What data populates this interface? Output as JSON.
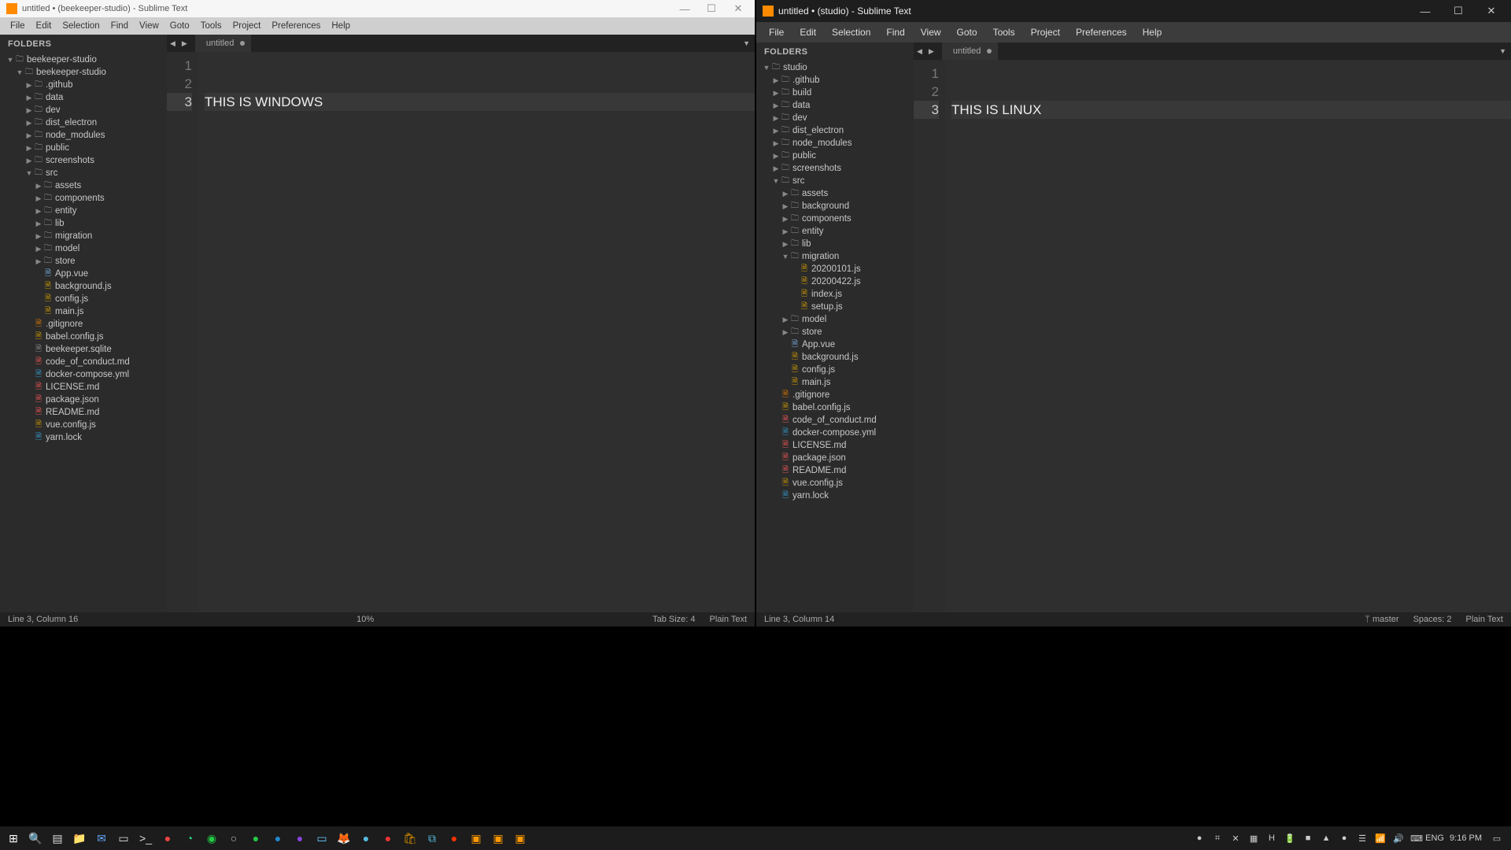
{
  "left": {
    "title": "untitled • (beekeeper-studio) - Sublime Text",
    "menus": [
      "File",
      "Edit",
      "Selection",
      "Find",
      "View",
      "Goto",
      "Tools",
      "Project",
      "Preferences",
      "Help"
    ],
    "folders_label": "FOLDERS",
    "tree": [
      {
        "d": 0,
        "exp": true,
        "kind": "folder",
        "name": "beekeeper-studio"
      },
      {
        "d": 1,
        "exp": true,
        "kind": "folder",
        "name": "beekeeper-studio"
      },
      {
        "d": 2,
        "exp": false,
        "kind": "folder",
        "name": ".github"
      },
      {
        "d": 2,
        "exp": false,
        "kind": "folder",
        "name": "data"
      },
      {
        "d": 2,
        "exp": false,
        "kind": "folder",
        "name": "dev"
      },
      {
        "d": 2,
        "exp": false,
        "kind": "folder",
        "name": "dist_electron"
      },
      {
        "d": 2,
        "exp": false,
        "kind": "folder",
        "name": "node_modules"
      },
      {
        "d": 2,
        "exp": false,
        "kind": "folder",
        "name": "public"
      },
      {
        "d": 2,
        "exp": false,
        "kind": "folder",
        "name": "screenshots"
      },
      {
        "d": 2,
        "exp": true,
        "kind": "folder",
        "name": "src"
      },
      {
        "d": 3,
        "exp": false,
        "kind": "folder",
        "name": "assets"
      },
      {
        "d": 3,
        "exp": false,
        "kind": "folder",
        "name": "components"
      },
      {
        "d": 3,
        "exp": false,
        "kind": "folder",
        "name": "entity"
      },
      {
        "d": 3,
        "exp": false,
        "kind": "folder",
        "name": "lib"
      },
      {
        "d": 3,
        "exp": false,
        "kind": "folder",
        "name": "migration"
      },
      {
        "d": 3,
        "exp": false,
        "kind": "folder",
        "name": "model"
      },
      {
        "d": 3,
        "exp": false,
        "kind": "folder",
        "name": "store"
      },
      {
        "d": 3,
        "kind": "file",
        "name": "App.vue",
        "color": "#7ad"
      },
      {
        "d": 3,
        "kind": "file",
        "name": "background.js",
        "color": "#c90"
      },
      {
        "d": 3,
        "kind": "file",
        "name": "config.js",
        "color": "#c90"
      },
      {
        "d": 3,
        "kind": "file",
        "name": "main.js",
        "color": "#c90"
      },
      {
        "d": 2,
        "kind": "file",
        "name": ".gitignore",
        "color": "#d70"
      },
      {
        "d": 2,
        "kind": "file",
        "name": "babel.config.js",
        "color": "#c90"
      },
      {
        "d": 2,
        "kind": "file",
        "name": "beekeeper.sqlite",
        "color": "#888"
      },
      {
        "d": 2,
        "kind": "file",
        "name": "code_of_conduct.md",
        "color": "#e55"
      },
      {
        "d": 2,
        "kind": "file",
        "name": "docker-compose.yml",
        "color": "#39c"
      },
      {
        "d": 2,
        "kind": "file",
        "name": "LICENSE.md",
        "color": "#e55"
      },
      {
        "d": 2,
        "kind": "file",
        "name": "package.json",
        "color": "#e55"
      },
      {
        "d": 2,
        "kind": "file",
        "name": "README.md",
        "color": "#e55"
      },
      {
        "d": 2,
        "kind": "file",
        "name": "vue.config.js",
        "color": "#c90"
      },
      {
        "d": 2,
        "kind": "file",
        "name": "yarn.lock",
        "color": "#39c"
      }
    ],
    "tab": "untitled",
    "lines": [
      "",
      "",
      "THIS IS WINDOWS"
    ],
    "status": {
      "pos": "Line 3, Column 16",
      "zoom": "10%",
      "tab": "Tab Size: 4",
      "syntax": "Plain Text"
    }
  },
  "right": {
    "title": "untitled • (studio) - Sublime Text",
    "menus": [
      "File",
      "Edit",
      "Selection",
      "Find",
      "View",
      "Goto",
      "Tools",
      "Project",
      "Preferences",
      "Help"
    ],
    "folders_label": "FOLDERS",
    "tree": [
      {
        "d": 0,
        "exp": true,
        "kind": "folder",
        "name": "studio"
      },
      {
        "d": 1,
        "exp": false,
        "kind": "folder",
        "name": ".github"
      },
      {
        "d": 1,
        "exp": false,
        "kind": "folder",
        "name": "build"
      },
      {
        "d": 1,
        "exp": false,
        "kind": "folder",
        "name": "data"
      },
      {
        "d": 1,
        "exp": false,
        "kind": "folder",
        "name": "dev"
      },
      {
        "d": 1,
        "exp": false,
        "kind": "folder",
        "name": "dist_electron"
      },
      {
        "d": 1,
        "exp": false,
        "kind": "folder",
        "name": "node_modules"
      },
      {
        "d": 1,
        "exp": false,
        "kind": "folder",
        "name": "public"
      },
      {
        "d": 1,
        "exp": false,
        "kind": "folder",
        "name": "screenshots"
      },
      {
        "d": 1,
        "exp": true,
        "kind": "folder",
        "name": "src"
      },
      {
        "d": 2,
        "exp": false,
        "kind": "folder",
        "name": "assets"
      },
      {
        "d": 2,
        "exp": false,
        "kind": "folder",
        "name": "background"
      },
      {
        "d": 2,
        "exp": false,
        "kind": "folder",
        "name": "components"
      },
      {
        "d": 2,
        "exp": false,
        "kind": "folder",
        "name": "entity"
      },
      {
        "d": 2,
        "exp": false,
        "kind": "folder",
        "name": "lib"
      },
      {
        "d": 2,
        "exp": true,
        "kind": "folder",
        "name": "migration"
      },
      {
        "d": 3,
        "kind": "file",
        "name": "20200101.js",
        "color": "#c90"
      },
      {
        "d": 3,
        "kind": "file",
        "name": "20200422.js",
        "color": "#c90"
      },
      {
        "d": 3,
        "kind": "file",
        "name": "index.js",
        "color": "#c90"
      },
      {
        "d": 3,
        "kind": "file",
        "name": "setup.js",
        "color": "#c90"
      },
      {
        "d": 2,
        "exp": false,
        "kind": "folder",
        "name": "model"
      },
      {
        "d": 2,
        "exp": false,
        "kind": "folder",
        "name": "store"
      },
      {
        "d": 2,
        "kind": "file",
        "name": "App.vue",
        "color": "#7ad"
      },
      {
        "d": 2,
        "kind": "file",
        "name": "background.js",
        "color": "#c90"
      },
      {
        "d": 2,
        "kind": "file",
        "name": "config.js",
        "color": "#c90"
      },
      {
        "d": 2,
        "kind": "file",
        "name": "main.js",
        "color": "#c90"
      },
      {
        "d": 1,
        "kind": "file",
        "name": ".gitignore",
        "color": "#d70"
      },
      {
        "d": 1,
        "kind": "file",
        "name": "babel.config.js",
        "color": "#c90"
      },
      {
        "d": 1,
        "kind": "file",
        "name": "code_of_conduct.md",
        "color": "#e55"
      },
      {
        "d": 1,
        "kind": "file",
        "name": "docker-compose.yml",
        "color": "#39c"
      },
      {
        "d": 1,
        "kind": "file",
        "name": "LICENSE.md",
        "color": "#e55"
      },
      {
        "d": 1,
        "kind": "file",
        "name": "package.json",
        "color": "#e55"
      },
      {
        "d": 1,
        "kind": "file",
        "name": "README.md",
        "color": "#e55"
      },
      {
        "d": 1,
        "kind": "file",
        "name": "vue.config.js",
        "color": "#c90"
      },
      {
        "d": 1,
        "kind": "file",
        "name": "yarn.lock",
        "color": "#39c"
      }
    ],
    "tab": "untitled",
    "lines": [
      "",
      "",
      "THIS IS LINUX"
    ],
    "status": {
      "pos": "Line 3, Column 14",
      "branch": "master",
      "spaces": "Spaces: 2",
      "syntax": "Plain Text"
    }
  },
  "taskbar": {
    "left_icons": [
      {
        "g": "⊞",
        "c": "#fff"
      },
      {
        "g": "🔍",
        "c": "#ddd"
      },
      {
        "g": "▤",
        "c": "#ddd"
      },
      {
        "g": "📁",
        "c": "#e8c060"
      },
      {
        "g": "✉",
        "c": "#6af"
      },
      {
        "g": "▭",
        "c": "#ddd"
      },
      {
        "g": ">_",
        "c": "#ddd"
      },
      {
        "g": "●",
        "c": "#e44"
      },
      {
        "g": "◔",
        "c": "#2d8"
      },
      {
        "g": "◉",
        "c": "#2c4"
      },
      {
        "g": "○",
        "c": "#bbb"
      },
      {
        "g": "●",
        "c": "#2c4"
      },
      {
        "g": "●",
        "c": "#28c"
      },
      {
        "g": "●",
        "c": "#84d"
      },
      {
        "g": "▭",
        "c": "#6cf"
      },
      {
        "g": "🦊",
        "c": "#f60"
      },
      {
        "g": "●",
        "c": "#5bd"
      },
      {
        "g": "●",
        "c": "#e33"
      },
      {
        "g": "🛍",
        "c": "#c80"
      },
      {
        "g": "⧉",
        "c": "#5bd"
      },
      {
        "g": "●",
        "c": "#f30"
      },
      {
        "g": "▣",
        "c": "#f90"
      },
      {
        "g": "▣",
        "c": "#f90"
      },
      {
        "g": "▣",
        "c": "#f90"
      }
    ],
    "tray_icons": [
      "●",
      "⌗",
      "✕",
      "▦",
      "H",
      "🔋",
      "■",
      "▲",
      "●",
      "☰",
      "📶",
      "🔊",
      "⌨",
      "ENG"
    ],
    "time": "9:16 PM",
    "notif": "▭"
  }
}
